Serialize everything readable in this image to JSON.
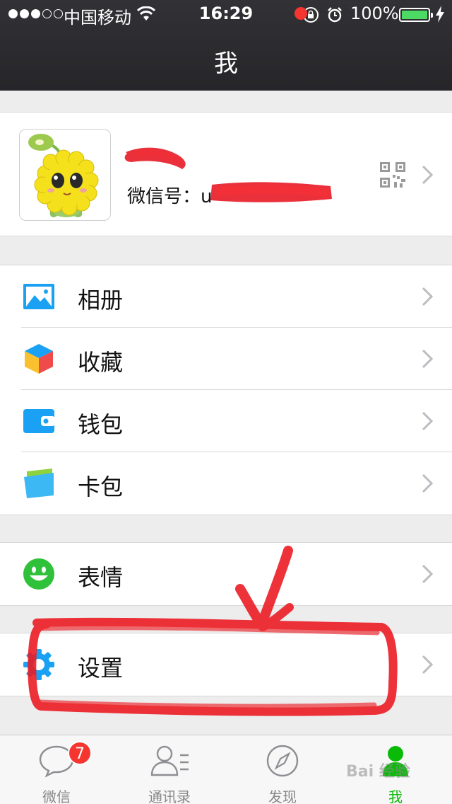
{
  "status_bar": {
    "carrier": "中国移动",
    "time": "16:29",
    "battery": "100%",
    "battery_level": 1.0
  },
  "nav": {
    "title": "我"
  },
  "profile": {
    "wechat_id_label": "微信号：",
    "wechat_id_prefix": "u"
  },
  "menu": {
    "album": "相册",
    "favorites": "收藏",
    "wallet": "钱包",
    "cards": "卡包",
    "stickers": "表情",
    "settings": "设置"
  },
  "tabbar": {
    "chats": "微信",
    "chats_badge": "7",
    "contacts": "通讯录",
    "discover": "发现",
    "me": "我"
  },
  "watermark": "Bai 经验",
  "colors": {
    "accent_green": "#09bb07",
    "badge_red": "#f43530",
    "icon_blue": "#1aa1f3"
  }
}
